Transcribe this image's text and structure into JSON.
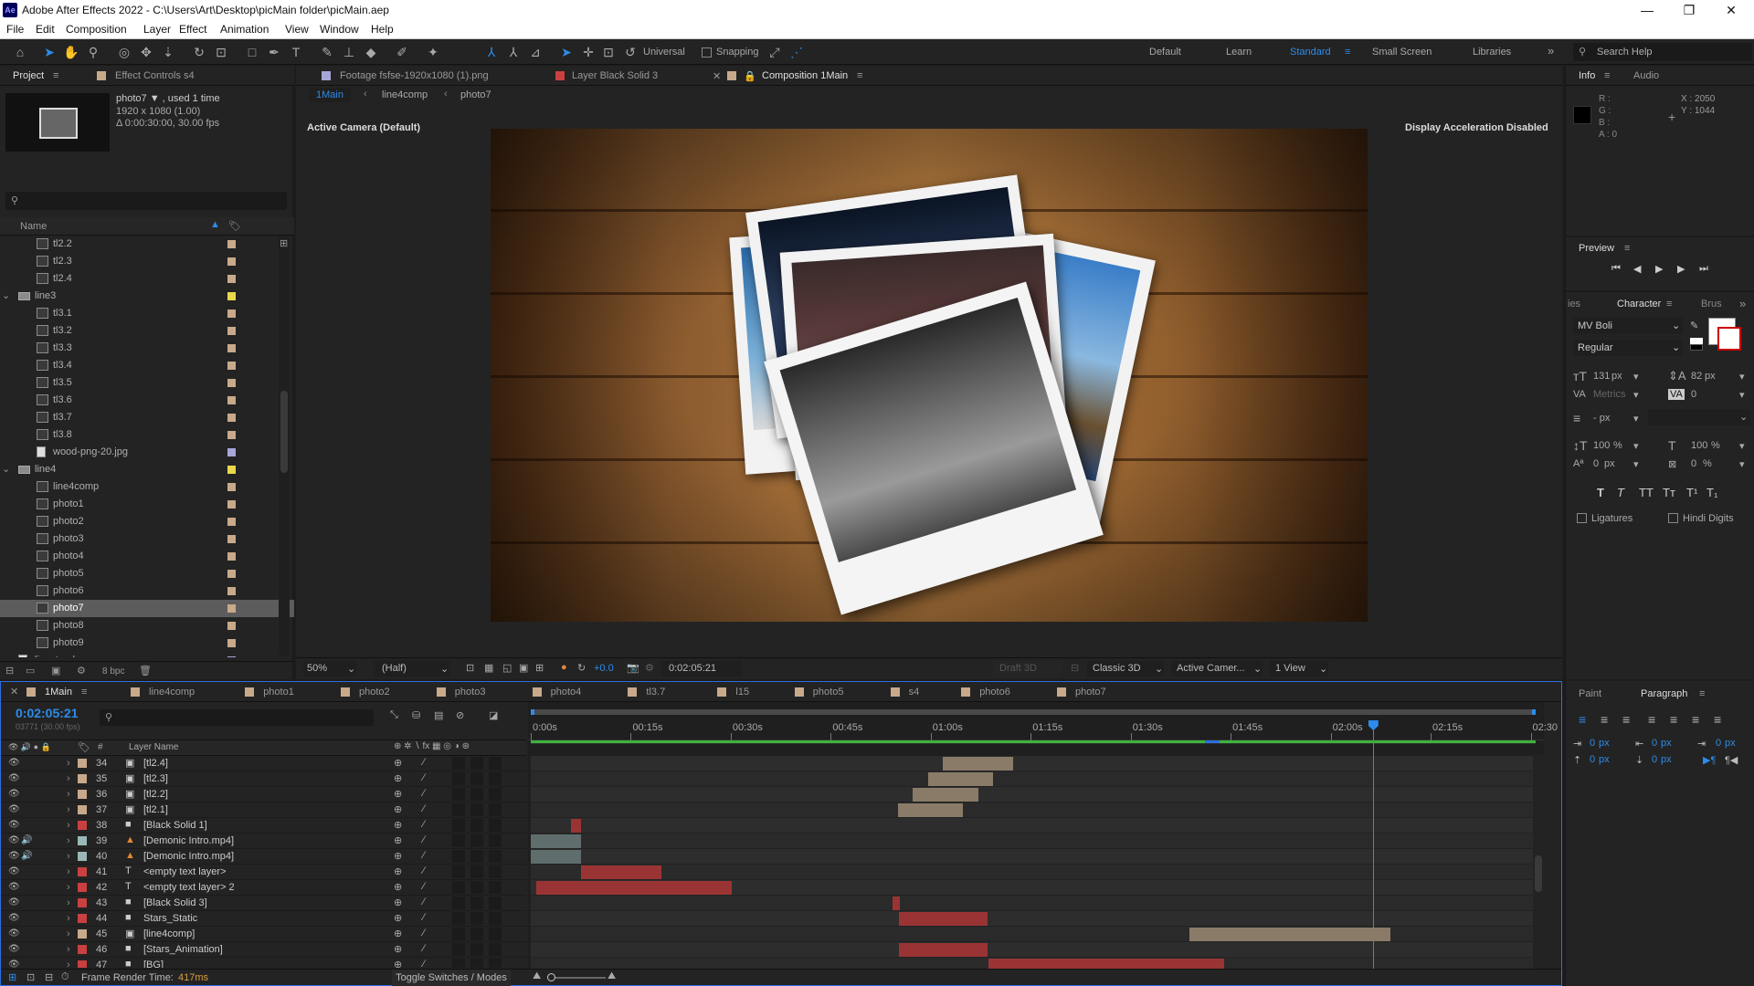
{
  "app": {
    "title": "Adobe After Effects 2022 - C:\\Users\\Art\\Desktop\\picMain folder\\picMain.aep",
    "logo": "Ae"
  },
  "menu": [
    "File",
    "Edit",
    "Composition",
    "Layer",
    "Effect",
    "Animation",
    "View",
    "Window",
    "Help"
  ],
  "toolbar": {
    "universal": "Universal",
    "snapping": "Snapping",
    "workspaces": [
      "Default",
      "Learn",
      "Standard",
      "Small Screen",
      "Libraries"
    ],
    "active_workspace": "Standard",
    "search_placeholder": "Search Help"
  },
  "project": {
    "tab": "Project",
    "effect_tab": "Effect Controls s4",
    "item_name": "photo7 ▼ , used 1 time",
    "item_size": "1920 x 1080 (1.00)",
    "item_duration": "Δ 0:00:30:00, 30.00 fps",
    "col_name": "Name",
    "bpc": "8 bpc",
    "rows": [
      {
        "name": "tl2.2",
        "indent": 2,
        "type": "comp",
        "color": "#c8a98a"
      },
      {
        "name": "tl2.3",
        "indent": 2,
        "type": "comp",
        "color": "#c8a98a"
      },
      {
        "name": "tl2.4",
        "indent": 2,
        "type": "comp",
        "color": "#c8a98a"
      },
      {
        "name": "line3",
        "indent": 1,
        "type": "folder",
        "color": "#e8d84a"
      },
      {
        "name": "tl3.1",
        "indent": 2,
        "type": "comp",
        "color": "#c8a98a"
      },
      {
        "name": "tl3.2",
        "indent": 2,
        "type": "comp",
        "color": "#c8a98a"
      },
      {
        "name": "tl3.3",
        "indent": 2,
        "type": "comp",
        "color": "#c8a98a"
      },
      {
        "name": "tl3.4",
        "indent": 2,
        "type": "comp",
        "color": "#c8a98a"
      },
      {
        "name": "tl3.5",
        "indent": 2,
        "type": "comp",
        "color": "#c8a98a"
      },
      {
        "name": "tl3.6",
        "indent": 2,
        "type": "comp",
        "color": "#c8a98a"
      },
      {
        "name": "tl3.7",
        "indent": 2,
        "type": "comp",
        "color": "#c8a98a"
      },
      {
        "name": "tl3.8",
        "indent": 2,
        "type": "comp",
        "color": "#c8a98a"
      },
      {
        "name": "wood-png-20.jpg",
        "indent": 2,
        "type": "file",
        "color": "#a6a6d8"
      },
      {
        "name": "line4",
        "indent": 1,
        "type": "folder",
        "color": "#e8d84a"
      },
      {
        "name": "line4comp",
        "indent": 2,
        "type": "comp",
        "color": "#c8a98a"
      },
      {
        "name": "photo1",
        "indent": 2,
        "type": "comp",
        "color": "#c8a98a"
      },
      {
        "name": "photo2",
        "indent": 2,
        "type": "comp",
        "color": "#c8a98a"
      },
      {
        "name": "photo3",
        "indent": 2,
        "type": "comp",
        "color": "#c8a98a"
      },
      {
        "name": "photo4",
        "indent": 2,
        "type": "comp",
        "color": "#c8a98a"
      },
      {
        "name": "photo5",
        "indent": 2,
        "type": "comp",
        "color": "#c8a98a"
      },
      {
        "name": "photo6",
        "indent": 2,
        "type": "comp",
        "color": "#c8a98a"
      },
      {
        "name": "photo7",
        "indent": 2,
        "type": "comp",
        "color": "#c8a98a",
        "selected": true
      },
      {
        "name": "photo8",
        "indent": 2,
        "type": "comp",
        "color": "#c8a98a"
      },
      {
        "name": "photo9",
        "indent": 2,
        "type": "comp",
        "color": "#c8a98a"
      },
      {
        "name": "linestand.png",
        "indent": 1,
        "type": "file",
        "color": "#a6a6d8"
      }
    ]
  },
  "viewer": {
    "tabs": [
      "Footage fsfse-1920x1080 (1).png",
      "Layer Black Solid 3",
      "Composition 1Main"
    ],
    "breadcrumbs": [
      "1Main",
      "line4comp",
      "photo7"
    ],
    "camera": "Active Camera (Default)",
    "accel": "Display Acceleration Disabled",
    "zoom": "50%",
    "resolution": "(Half)",
    "exposure": "+0.0",
    "timecode": "0:02:05:21",
    "draft3d": "Draft 3D",
    "renderer": "Classic 3D",
    "view_camera": "Active Camer...",
    "views": "1 View"
  },
  "info": {
    "tab": "Info",
    "audio_tab": "Audio",
    "r": "R :",
    "g": "G :",
    "b": "B :",
    "a": "A : 0",
    "x": "X : 2050",
    "y": "Y : 1044"
  },
  "preview": {
    "tab": "Preview"
  },
  "character": {
    "tab": "Character",
    "left_tab": "ies",
    "right_tab": "Brus",
    "font": "MV Boli",
    "style": "Regular",
    "size": "131",
    "size_unit": "px",
    "leading": "82",
    "leading_unit": "px",
    "kerning": "Metrics",
    "tracking": "0",
    "line_unit": "- px",
    "vscale": "100",
    "hscale": "100",
    "pct": "%",
    "baseline": "0",
    "baseline_unit": "px",
    "tsume": "0",
    "tsume_unit": "%",
    "ligatures": "Ligatures",
    "hindi": "Hindi Digits",
    "styles": [
      "T",
      "T",
      "TT",
      "Tт",
      "T¹",
      "T₁"
    ]
  },
  "paragraph": {
    "paint_tab": "Paint",
    "tab": "Paragraph",
    "indent_vals": [
      "0",
      "px",
      "0",
      "px",
      "0",
      "px",
      "0",
      "px",
      "0",
      "px"
    ]
  },
  "timeline": {
    "tabs": [
      "1Main",
      "line4comp",
      "photo1",
      "photo2",
      "photo3",
      "photo4",
      "tl3.7",
      "l15",
      "photo5",
      "s4",
      "photo6",
      "photo7"
    ],
    "tab_colors": [
      "#c8a98a",
      "#c8a98a",
      "#c8a98a",
      "#c8a98a",
      "#c8a98a",
      "#c8a98a",
      "#c8a98a",
      "#c8a98a",
      "#c8a98a",
      "#c8a98a",
      "#c8a98a",
      "#c8a98a"
    ],
    "timecode": "0:02:05:21",
    "frames": "03771 (30.00 fps)",
    "col_layer": "Layer Name",
    "col_hash": "#",
    "ruler": [
      "0:00s",
      "00:15s",
      "00:30s",
      "00:45s",
      "01:00s",
      "01:15s",
      "01:30s",
      "01:45s",
      "02:00s",
      "02:15s",
      "02:30"
    ],
    "render_label": "Frame Render Time:",
    "render_value": "417ms",
    "toggle": "Toggle Switches / Modes",
    "layers": [
      {
        "num": "34",
        "name": "[tl2.4]",
        "type": "comp",
        "color": "#c8a98a",
        "bar_start": 0.41,
        "bar_end": 0.48,
        "bar_color": "#8a7b68"
      },
      {
        "num": "35",
        "name": "[tl2.3]",
        "type": "comp",
        "color": "#c8a98a",
        "bar_start": 0.395,
        "bar_end": 0.46,
        "bar_color": "#8a7b68"
      },
      {
        "num": "36",
        "name": "[tl2.2]",
        "type": "comp",
        "color": "#c8a98a",
        "bar_start": 0.38,
        "bar_end": 0.445,
        "bar_color": "#8a7b68"
      },
      {
        "num": "37",
        "name": "[tl2.1]",
        "type": "comp",
        "color": "#c8a98a",
        "bar_start": 0.365,
        "bar_end": 0.43,
        "bar_color": "#8a7b68"
      },
      {
        "num": "38",
        "name": "[Black Solid 1]",
        "type": "solid",
        "color": "#c84040",
        "bar_start": 0.04,
        "bar_end": 0.05,
        "bar_color": "#9a3434"
      },
      {
        "num": "39",
        "name": "[Demonic Intro.mp4]",
        "type": "footage",
        "color": "#9ab8b8",
        "bar_start": 0.0,
        "bar_end": 0.05,
        "bar_color": "#5f6d6d"
      },
      {
        "num": "40",
        "name": "[Demonic Intro.mp4]",
        "type": "footage",
        "color": "#9ab8b8",
        "bar_start": 0.0,
        "bar_end": 0.05,
        "bar_color": "#5f6d6d"
      },
      {
        "num": "41",
        "name": "<empty text layer>",
        "type": "text",
        "color": "#c84040",
        "bar_start": 0.05,
        "bar_end": 0.13,
        "bar_color": "#9a3434"
      },
      {
        "num": "42",
        "name": "<empty text layer> 2",
        "type": "text",
        "color": "#c84040",
        "bar_start": 0.005,
        "bar_end": 0.2,
        "bar_color": "#9a3434"
      },
      {
        "num": "43",
        "name": "[Black Solid 3]",
        "type": "solid",
        "color": "#c84040",
        "bar_start": 0.36,
        "bar_end": 0.367,
        "bar_color": "#9a3434"
      },
      {
        "num": "44",
        "name": "Stars_Static",
        "type": "solid",
        "color": "#c84040",
        "bar_start": 0.366,
        "bar_end": 0.455,
        "bar_color": "#9a3434"
      },
      {
        "num": "45",
        "name": "[line4comp]",
        "type": "comp",
        "color": "#c8a98a",
        "bar_start": 0.655,
        "bar_end": 0.855,
        "bar_color": "#8a7b68"
      },
      {
        "num": "46",
        "name": "[Stars_Animation]",
        "type": "solid",
        "color": "#c84040",
        "bar_start": 0.366,
        "bar_end": 0.455,
        "bar_color": "#9a3434"
      },
      {
        "num": "47",
        "name": "[BG]",
        "type": "solid",
        "color": "#c84040",
        "bar_start": 0.455,
        "bar_end": 0.69,
        "bar_color": "#9a3434"
      }
    ],
    "playhead": 0.838
  }
}
